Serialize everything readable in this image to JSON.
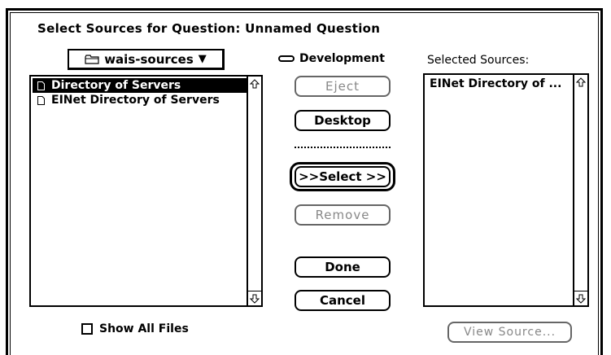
{
  "dialog": {
    "title": "Select Sources for Question:  Unnamed Question"
  },
  "folder_popup": {
    "label": "wais-sources",
    "icon": "folder-icon",
    "arrow": "▼"
  },
  "source_list": {
    "items": [
      {
        "label": "Directory of Servers",
        "selected": true
      },
      {
        "label": "EINet Directory of Servers",
        "selected": false
      }
    ]
  },
  "volume": {
    "label": "Development",
    "icon": "drive-icon"
  },
  "buttons": {
    "eject": "Eject",
    "desktop": "Desktop",
    "select": ">>Select >>",
    "remove": "Remove",
    "done": "Done",
    "cancel": "Cancel",
    "view_source": "View Source..."
  },
  "selected_sources": {
    "label": "Selected Sources:",
    "items": [
      {
        "label": "EINet Directory of ..."
      }
    ]
  },
  "show_all_files": {
    "label": "Show All Files",
    "checked": false
  },
  "colors": {
    "foreground": "#000000",
    "background": "#ffffff",
    "disabled": "#888888"
  }
}
